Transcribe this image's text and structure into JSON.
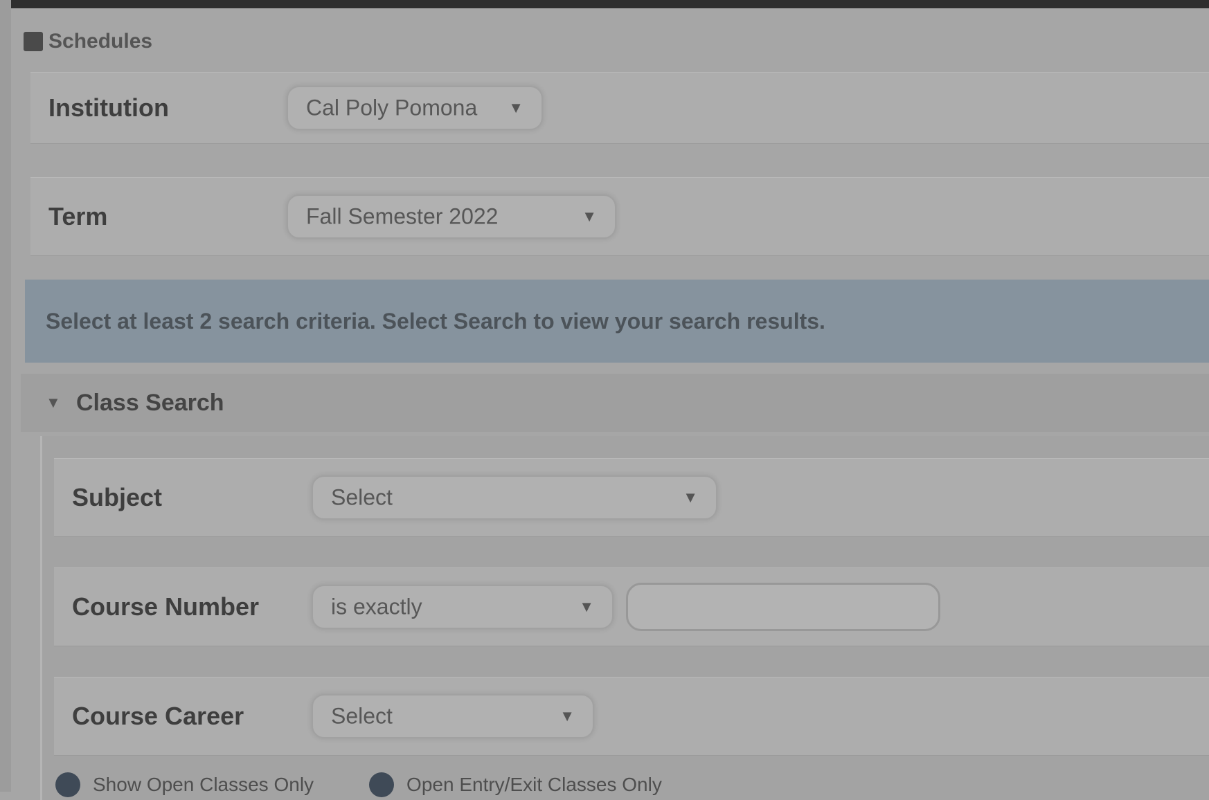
{
  "header": {
    "title": "Schedules"
  },
  "fields": {
    "institution": {
      "label": "Institution",
      "value": "Cal Poly Pomona"
    },
    "term": {
      "label": "Term",
      "value": "Fall Semester 2022"
    }
  },
  "info_banner": {
    "text": "Select at least 2 search criteria. Select Search to view your search results."
  },
  "class_search": {
    "title": "Class Search",
    "subject": {
      "label": "Subject",
      "value": "Select"
    },
    "course_number": {
      "label": "Course Number",
      "operator": "is exactly",
      "value": ""
    },
    "course_career": {
      "label": "Course Career",
      "value": "Select"
    },
    "checkboxes": [
      {
        "label": "Show Open Classes Only"
      },
      {
        "label": "Open Entry/Exit Classes Only"
      }
    ]
  },
  "colors": {
    "banner": "#86939e",
    "background": "#a6a6a6"
  }
}
